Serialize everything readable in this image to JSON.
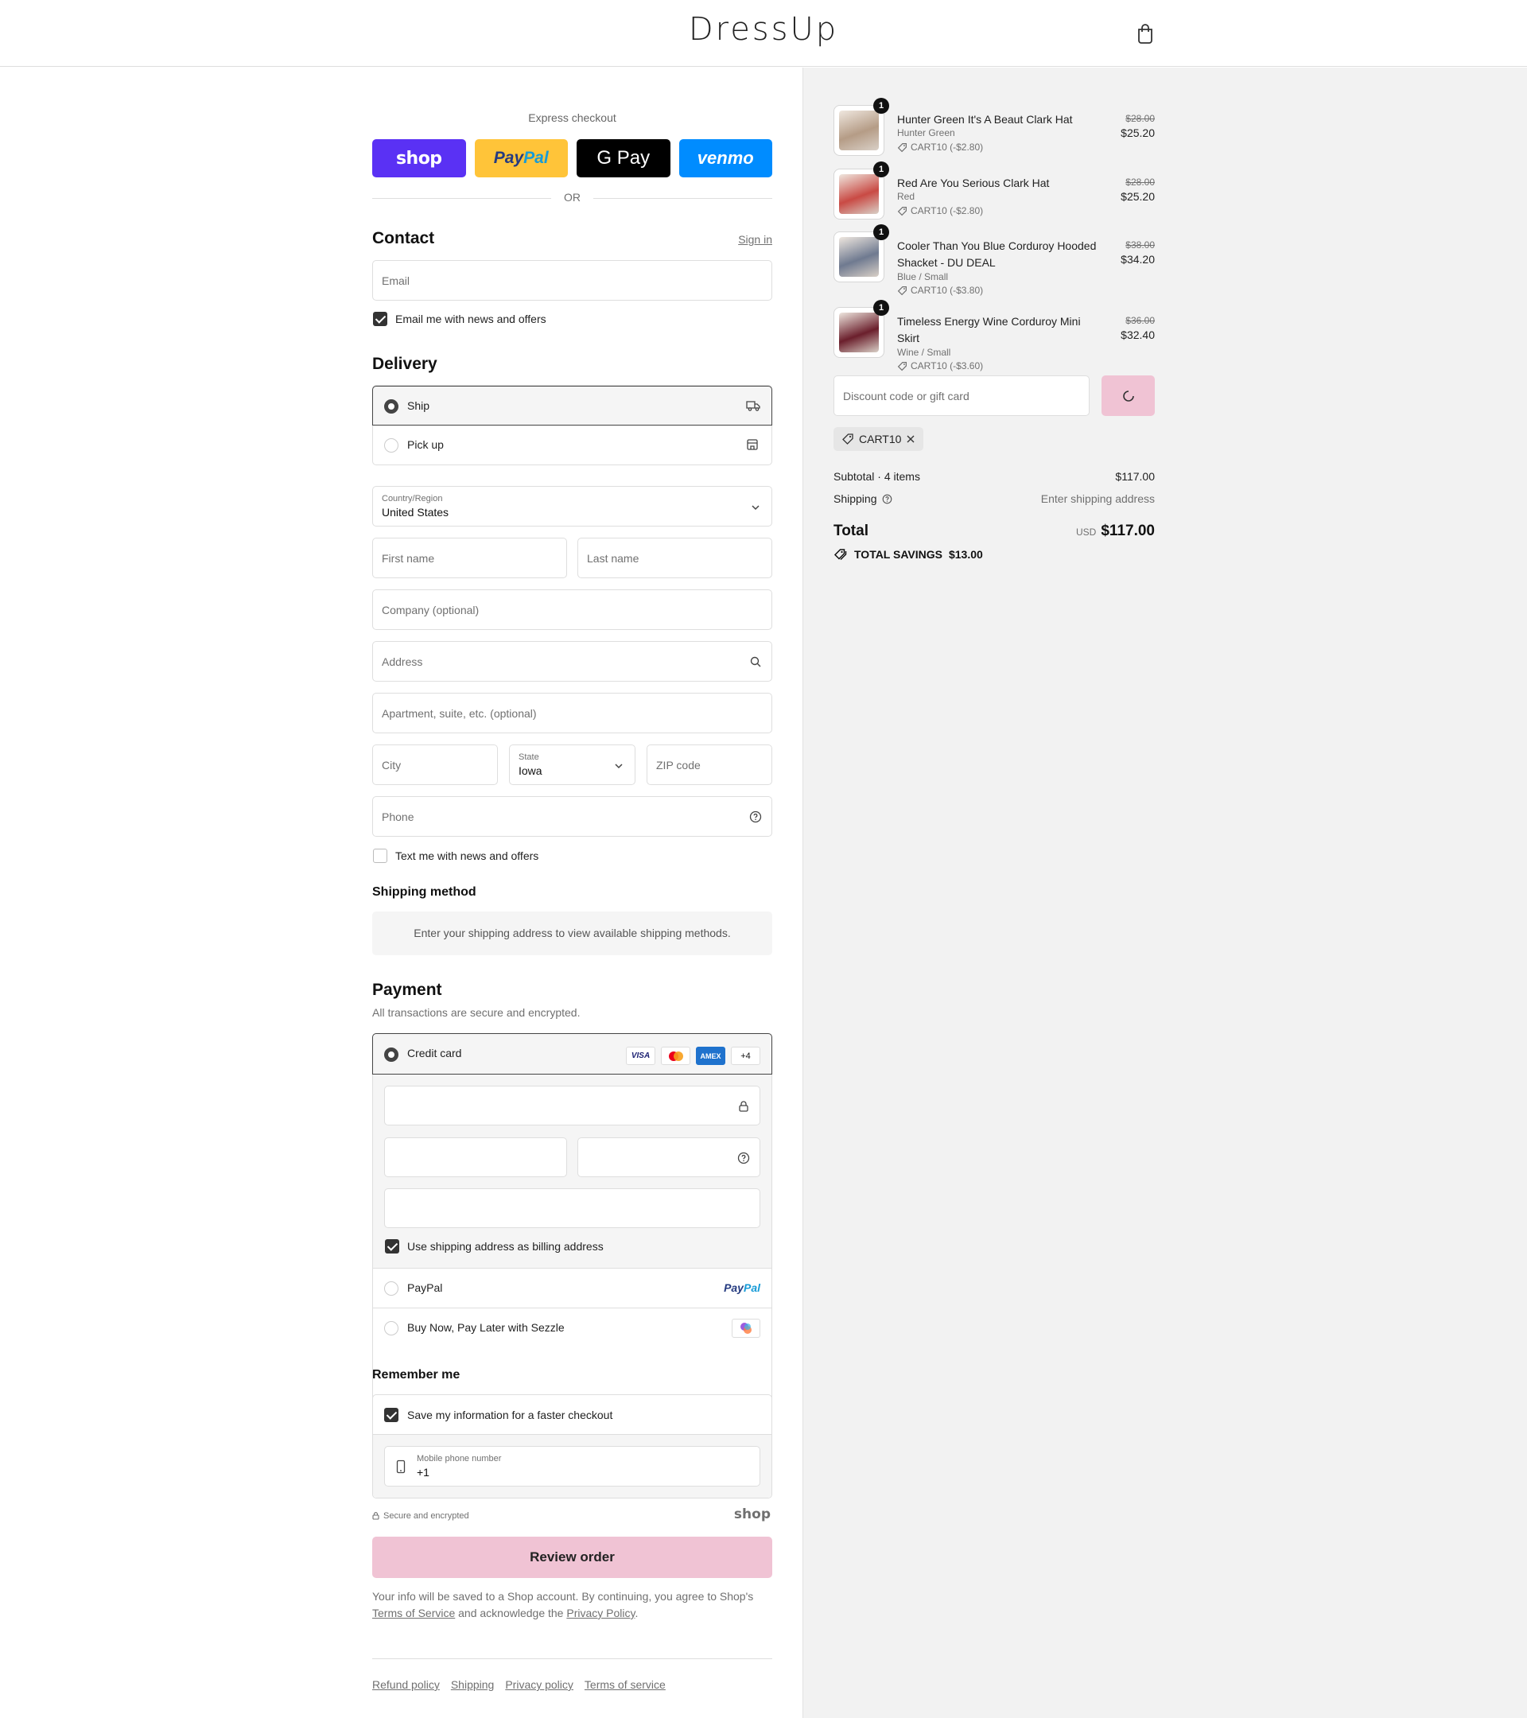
{
  "header": {
    "brand": "DressUp",
    "cart_icon": "shopping-bag-icon"
  },
  "express": {
    "label": "Express checkout",
    "buttons": {
      "shop": "shop",
      "paypal": "PayPal",
      "gpay": "G Pay",
      "venmo": "venmo"
    },
    "or": "OR"
  },
  "contact": {
    "title": "Contact",
    "sign_in": "Sign in",
    "email_placeholder": "Email",
    "news_label": "Email me with news and offers",
    "news_checked": true
  },
  "delivery": {
    "title": "Delivery",
    "options": [
      {
        "label": "Ship",
        "icon": "truck-icon",
        "selected": true
      },
      {
        "label": "Pick up",
        "icon": "store-icon",
        "selected": false
      }
    ],
    "country_label": "Country/Region",
    "country_value": "United States",
    "first_name": "First name",
    "last_name": "Last name",
    "company": "Company (optional)",
    "address": "Address",
    "apartment": "Apartment, suite, etc. (optional)",
    "city": "City",
    "state_label": "State",
    "state_value": "Iowa",
    "zip": "ZIP code",
    "phone": "Phone",
    "text_label": "Text me with news and offers",
    "text_checked": false
  },
  "shipping_method": {
    "title": "Shipping method",
    "message": "Enter your shipping address to view available shipping methods."
  },
  "payment": {
    "title": "Payment",
    "subtitle": "All transactions are secure and encrypted.",
    "credit_card": "Credit card",
    "card_logos": [
      "VISA",
      "MC",
      "AMEX",
      "+4"
    ],
    "billing_label": "Use shipping address as billing address",
    "billing_checked": true,
    "paypal": "PayPal",
    "paypal_logo": "PayPal",
    "sezzle": "Buy Now, Pay Later with Sezzle"
  },
  "remember": {
    "title": "Remember me",
    "save_label": "Save my information for a faster checkout",
    "save_checked": true,
    "mobile_label": "Mobile phone number",
    "mobile_value": "+1",
    "secure": "Secure and encrypted",
    "shop_logo": "shop"
  },
  "review": {
    "button": "Review order",
    "legal_1": "Your info will be saved to a Shop account. By continuing, you agree to Shop's",
    "terms": "Terms of Service",
    "legal_2": "and acknowledge the",
    "privacy": "Privacy Policy",
    "legal_end": "."
  },
  "footer": {
    "links": [
      "Refund policy",
      "Shipping",
      "Privacy policy",
      "Terms of service"
    ]
  },
  "cart": {
    "items": [
      {
        "qty": "1",
        "name": "Hunter Green It's A Beaut Clark Hat",
        "variant": "Hunter Green",
        "discount": "CART10 (-$2.80)",
        "old_price": "$28.00",
        "price": "$25.20",
        "color": "#b59c86"
      },
      {
        "qty": "1",
        "name": "Red Are You Serious Clark Hat",
        "variant": "Red",
        "discount": "CART10 (-$2.80)",
        "old_price": "$28.00",
        "price": "$25.20",
        "color": "#c94a44"
      },
      {
        "qty": "1",
        "name": "Cooler Than You Blue Corduroy Hooded Shacket - DU DEAL",
        "variant": "Blue / Small",
        "discount": "CART10 (-$3.80)",
        "old_price": "$38.00",
        "price": "$34.20",
        "color": "#6f7a90"
      },
      {
        "qty": "1",
        "name": "Timeless Energy Wine Corduroy Mini Skirt",
        "variant": "Wine / Small",
        "discount": "CART10 (-$3.60)",
        "old_price": "$36.00",
        "price": "$32.40",
        "color": "#6b1f2c"
      }
    ],
    "discount_placeholder": "Discount code or gift card",
    "applied_code": "CART10",
    "subtotal_label": "Subtotal · 4 items",
    "subtotal_value": "$117.00",
    "shipping_label": "Shipping",
    "shipping_value": "Enter shipping address",
    "total_label": "Total",
    "currency": "USD",
    "total_value": "$117.00",
    "savings_label": "TOTAL SAVINGS",
    "savings_value": "$13.00"
  }
}
